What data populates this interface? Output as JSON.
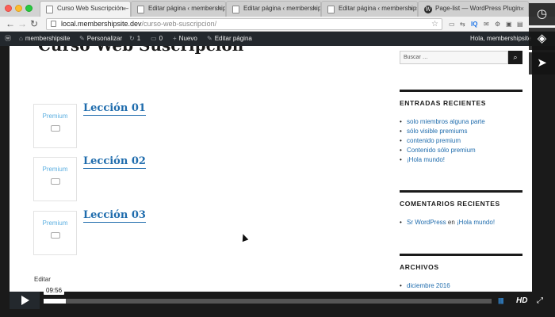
{
  "browser": {
    "tabs": [
      {
        "label": "Curso Web Suscripción – mem",
        "active": true,
        "favicon": "page-icon"
      },
      {
        "label": "Editar página ‹ membershipsite",
        "active": false,
        "favicon": "page-icon"
      },
      {
        "label": "Editar página ‹ membershipsite",
        "active": false,
        "favicon": "page-icon"
      },
      {
        "label": "Editar página ‹ membershipsite",
        "active": false,
        "favicon": "page-icon"
      },
      {
        "label": "Page-list — WordPress Plugin",
        "active": false,
        "favicon": "wordpress-icon"
      }
    ],
    "url_host": "local.membershipsite.dev",
    "url_path": "/curso-web-suscripcion/"
  },
  "admin_bar": {
    "site_name": "membershipsite",
    "customize": "Personalizar",
    "updates_count": "1",
    "comments_count": "0",
    "new": "Nuevo",
    "edit_page": "Editar página",
    "greeting": "Hola, membershipsite"
  },
  "main": {
    "lessons": [
      {
        "title": "Lección 01",
        "badge": "Premium"
      },
      {
        "title": "Lección 02",
        "badge": "Premium"
      },
      {
        "title": "Lección 03",
        "badge": "Premium"
      }
    ],
    "edit_link": "Editar"
  },
  "sidebar": {
    "search_placeholder": "Buscar …",
    "recent_posts": {
      "title": "ENTRADAS RECIENTES",
      "items": [
        "solo miembros alguna parte",
        "sólo visible premiums",
        "contenido premium",
        "Contenido sólo premium",
        "¡Hola mundo!"
      ]
    },
    "recent_comments": {
      "title": "COMENTARIOS RECIENTES",
      "author": "Sr WordPress",
      "connector": "en",
      "post": "¡Hola mundo!"
    },
    "archives": {
      "title": "ARCHIVOS",
      "items": [
        "diciembre 2016"
      ]
    }
  },
  "player": {
    "time": "09:56",
    "progress": 0.05,
    "hd_label": "HD"
  },
  "colors": {
    "link": "#1f6cad",
    "admin_bar": "#23282d",
    "premium_badge": "#5aaee0"
  }
}
